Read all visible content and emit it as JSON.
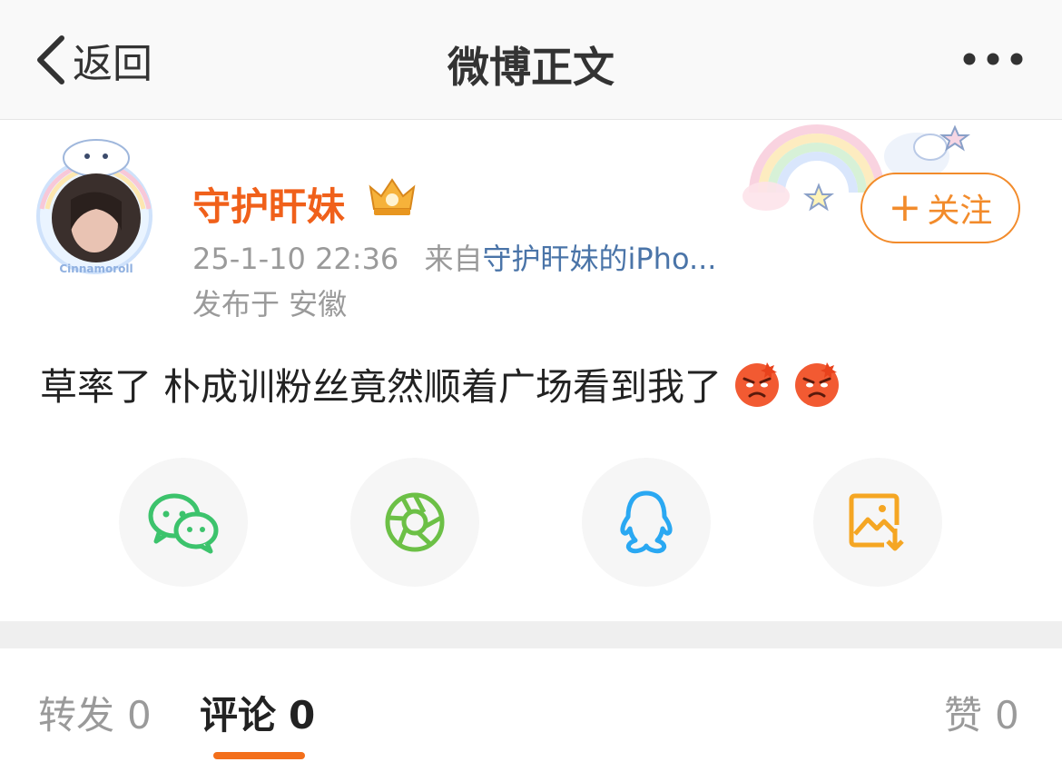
{
  "nav": {
    "back_label": "返回",
    "title": "微博正文"
  },
  "post": {
    "username": "守护盰妹",
    "timestamp": "25-1-10 22:36",
    "source_prefix": "来自",
    "source": "守护盰妹的iPho...",
    "location": "发布于 安徽",
    "follow_label": "关注",
    "text": "草率了 朴成训粉丝竟然顺着广场看到我了",
    "emojis": [
      "angry-face-emoji",
      "angry-face-emoji"
    ]
  },
  "share": {
    "items": [
      {
        "icon": "wechat-icon",
        "color": "#3cc36c"
      },
      {
        "icon": "moments-icon",
        "color": "#6cc046"
      },
      {
        "icon": "qq-icon",
        "color": "#2aa8f2"
      },
      {
        "icon": "save-image-icon",
        "color": "#f5a623"
      }
    ]
  },
  "tabs": {
    "repost_label": "转发",
    "repost_count": "0",
    "comment_label": "评论",
    "comment_count": "0",
    "like_label": "赞",
    "like_count": "0"
  },
  "colors": {
    "accent": "#f36f1b",
    "username": "#f0601a",
    "link": "#4a74a8"
  }
}
